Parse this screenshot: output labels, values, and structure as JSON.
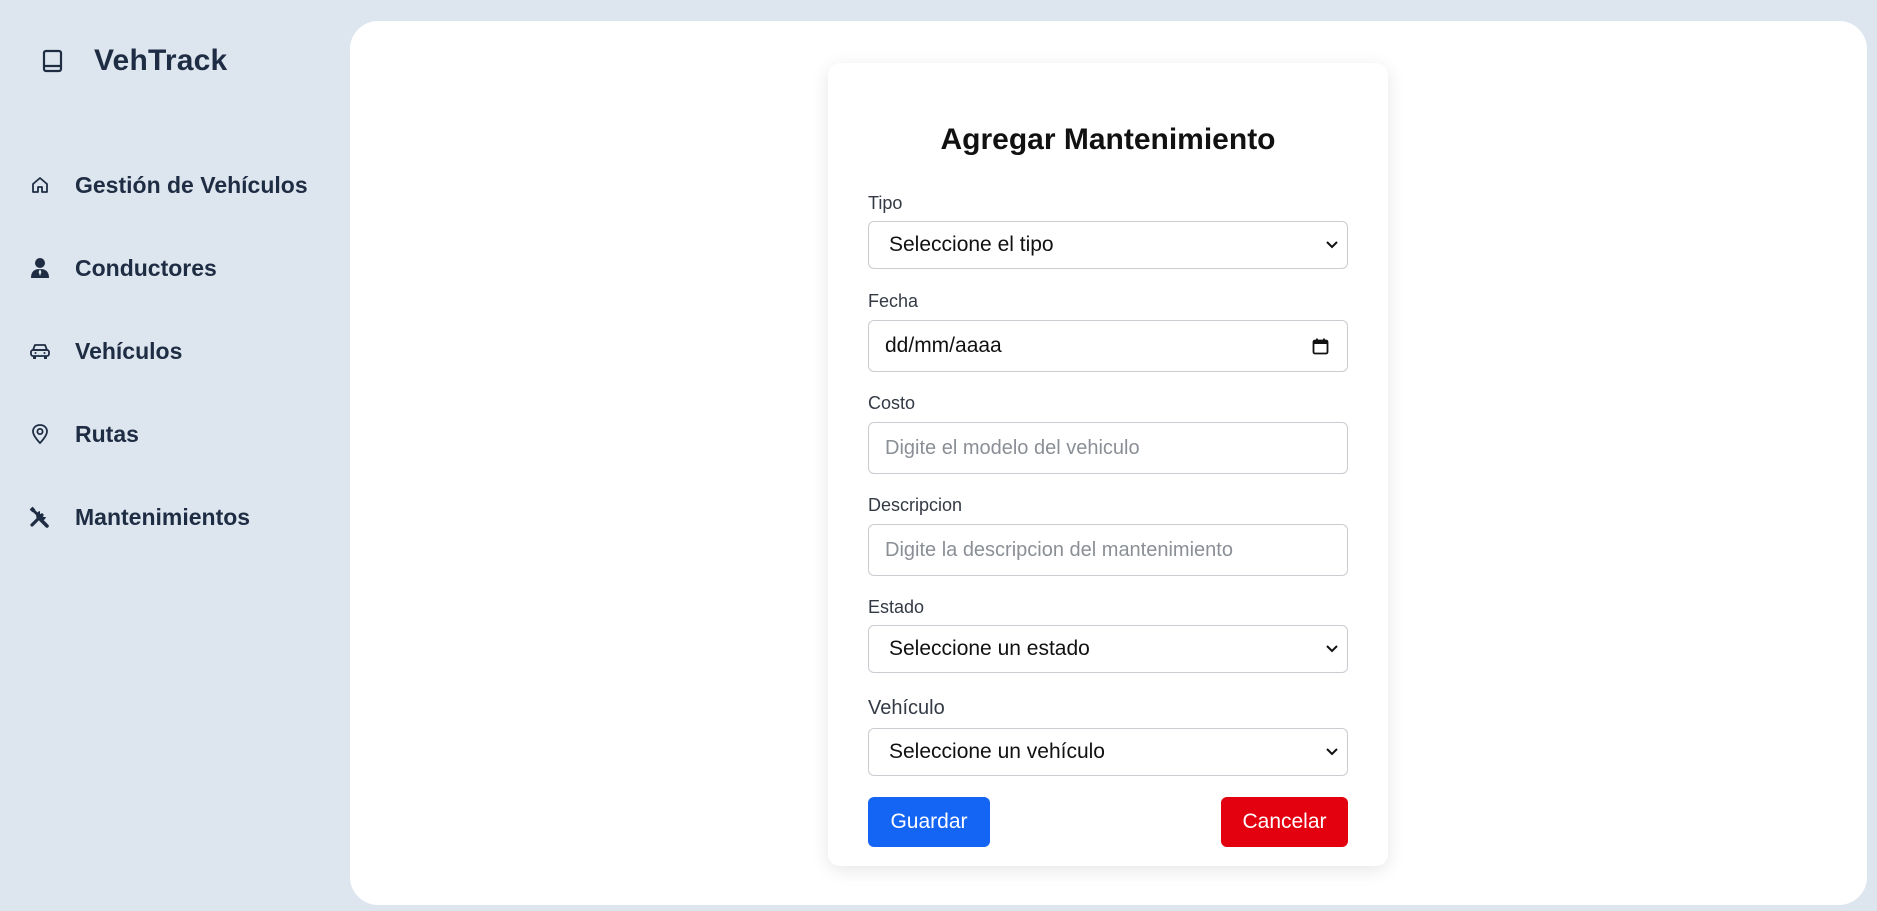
{
  "brand": {
    "name": "VehTrack",
    "icon": "book-icon"
  },
  "sidebar": {
    "items": [
      {
        "label": "Gestión de Vehículos",
        "icon": "home-icon"
      },
      {
        "label": "Conductores",
        "icon": "user-tie-icon"
      },
      {
        "label": "Vehículos",
        "icon": "car-icon"
      },
      {
        "label": "Rutas",
        "icon": "map-pin-icon"
      },
      {
        "label": "Mantenimientos",
        "icon": "tools-icon"
      }
    ]
  },
  "form": {
    "title": "Agregar Mantenimiento",
    "tipo": {
      "label": "Tipo",
      "value": "Seleccione el tipo"
    },
    "fecha": {
      "label": "Fecha",
      "value": "dd/mm/aaaa"
    },
    "costo": {
      "label": "Costo",
      "placeholder": "Digite el modelo del vehiculo"
    },
    "descripcion": {
      "label": "Descripcion",
      "placeholder": "Digite la descripcion del mantenimiento"
    },
    "estado": {
      "label": "Estado",
      "value": "Seleccione un estado"
    },
    "vehiculo": {
      "label": "Vehículo",
      "value": "Seleccione un vehículo"
    },
    "save_label": "Guardar",
    "cancel_label": "Cancelar"
  },
  "colors": {
    "background": "#dde6ee",
    "text": "#1f2d44",
    "save_button": "#1565f5",
    "cancel_button": "#e3000f"
  }
}
